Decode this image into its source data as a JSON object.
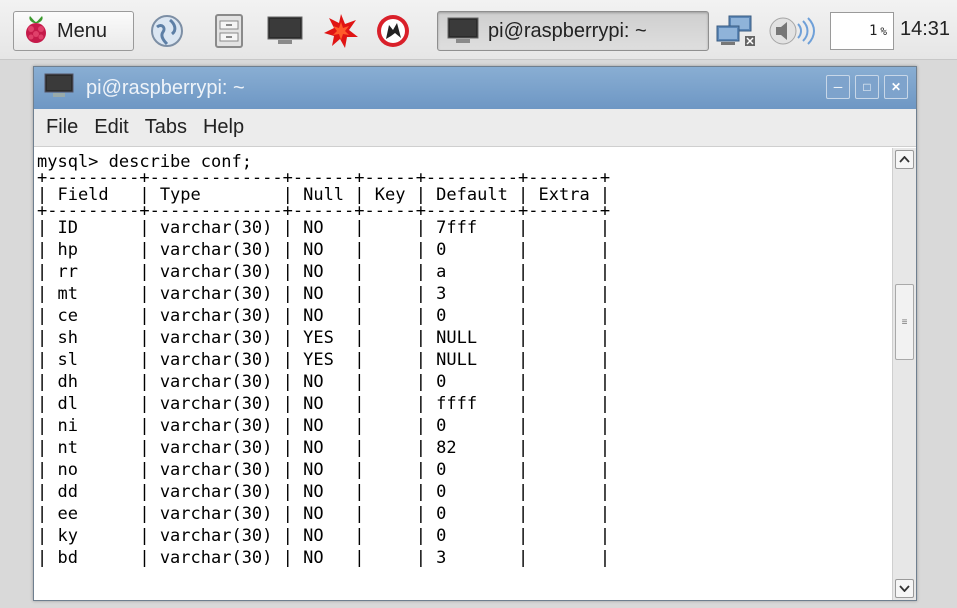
{
  "taskbar": {
    "menu_label": "Menu",
    "launchers": [
      "web-browser-icon",
      "file-manager-icon",
      "terminal-icon",
      "mathematica-icon",
      "wolfram-icon"
    ],
    "task_button_label": "pi@raspberrypi: ~",
    "cpu_value": "1",
    "cpu_unit": "%",
    "clock": "14:31"
  },
  "window": {
    "title": "pi@raspberrypi: ~",
    "menus": [
      "File",
      "Edit",
      "Tabs",
      "Help"
    ],
    "controls": [
      "minimize",
      "maximize",
      "close"
    ]
  },
  "terminal": {
    "command_line": "mysql> describe conf;",
    "border_line": "+---------+-------------+------+-----+---------+-------+",
    "columns": [
      "Field",
      "Type",
      "Null",
      "Key",
      "Default",
      "Extra"
    ],
    "rows": [
      [
        "ID",
        "varchar(30)",
        "NO",
        "",
        "7fff",
        ""
      ],
      [
        "hp",
        "varchar(30)",
        "NO",
        "",
        "0",
        ""
      ],
      [
        "rr",
        "varchar(30)",
        "NO",
        "",
        "a",
        ""
      ],
      [
        "mt",
        "varchar(30)",
        "NO",
        "",
        "3",
        ""
      ],
      [
        "ce",
        "varchar(30)",
        "NO",
        "",
        "0",
        ""
      ],
      [
        "sh",
        "varchar(30)",
        "YES",
        "",
        "NULL",
        ""
      ],
      [
        "sl",
        "varchar(30)",
        "YES",
        "",
        "NULL",
        ""
      ],
      [
        "dh",
        "varchar(30)",
        "NO",
        "",
        "0",
        ""
      ],
      [
        "dl",
        "varchar(30)",
        "NO",
        "",
        "ffff",
        ""
      ],
      [
        "ni",
        "varchar(30)",
        "NO",
        "",
        "0",
        ""
      ],
      [
        "nt",
        "varchar(30)",
        "NO",
        "",
        "82",
        ""
      ],
      [
        "no",
        "varchar(30)",
        "NO",
        "",
        "0",
        ""
      ],
      [
        "dd",
        "varchar(30)",
        "NO",
        "",
        "0",
        ""
      ],
      [
        "ee",
        "varchar(30)",
        "NO",
        "",
        "0",
        ""
      ],
      [
        "ky",
        "varchar(30)",
        "NO",
        "",
        "0",
        ""
      ],
      [
        "bd",
        "varchar(30)",
        "NO",
        "",
        "3",
        ""
      ]
    ]
  },
  "colors": {
    "titlebar": "#7aa1cb",
    "terminal_bg": "#ffffff",
    "terminal_fg": "#000000"
  }
}
